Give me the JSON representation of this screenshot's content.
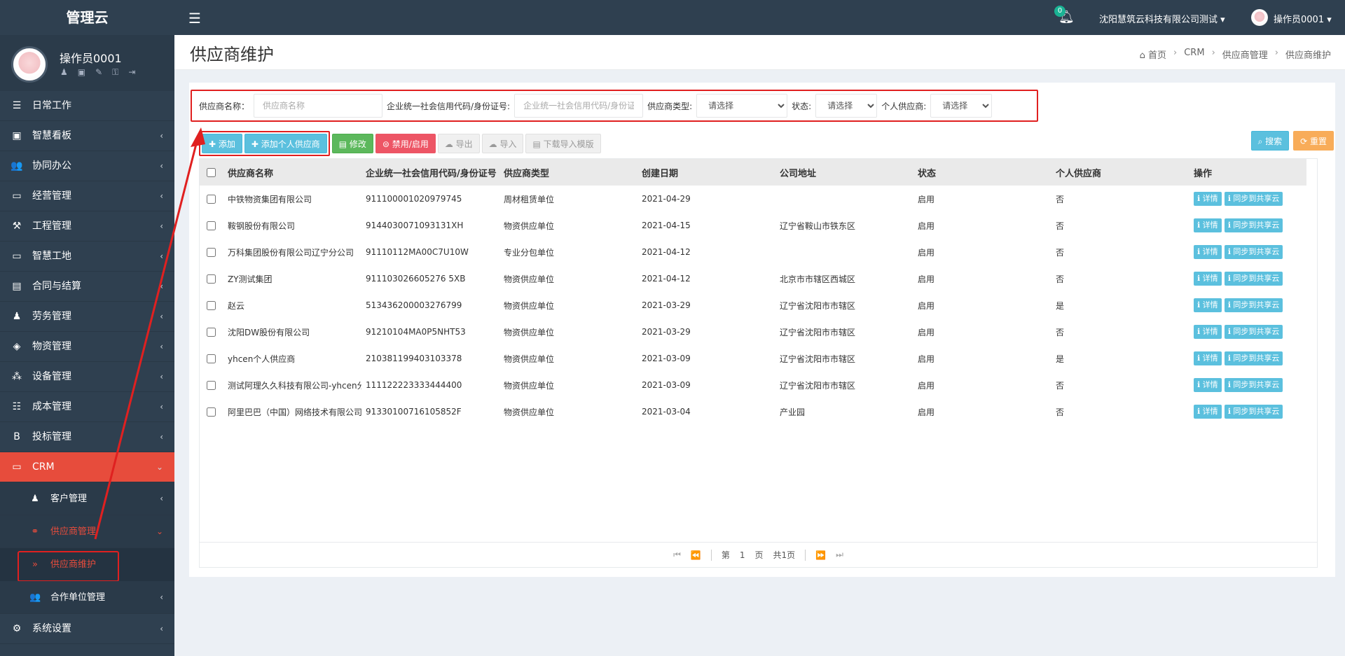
{
  "app": {
    "logo": "管理云"
  },
  "sidebar": {
    "user_name": "操作员0001",
    "menu": [
      {
        "label": "日常工作",
        "icon": "list-icon",
        "glyph": "☰",
        "arrow": ""
      },
      {
        "label": "智慧看板",
        "icon": "dashboard-icon",
        "glyph": "▣",
        "arrow": "‹"
      },
      {
        "label": "协同办公",
        "icon": "users-icon",
        "glyph": "👥",
        "arrow": "‹"
      },
      {
        "label": "经营管理",
        "icon": "monitor-icon",
        "glyph": "▭",
        "arrow": "‹"
      },
      {
        "label": "工程管理",
        "icon": "gavel-icon",
        "glyph": "⚒",
        "arrow": "‹"
      },
      {
        "label": "智慧工地",
        "icon": "monitor-icon",
        "glyph": "▭",
        "arrow": "‹"
      },
      {
        "label": "合同与结算",
        "icon": "file-icon",
        "glyph": "▤",
        "arrow": "‹"
      },
      {
        "label": "劳务管理",
        "icon": "worker-icon",
        "glyph": "♟",
        "arrow": "‹"
      },
      {
        "label": "物资管理",
        "icon": "cube-icon",
        "glyph": "◈",
        "arrow": "‹"
      },
      {
        "label": "设备管理",
        "icon": "cubes-icon",
        "glyph": "⁂",
        "arrow": "‹"
      },
      {
        "label": "成本管理",
        "icon": "list-icon",
        "glyph": "☷",
        "arrow": "‹"
      },
      {
        "label": "投标管理",
        "icon": "bold-icon",
        "glyph": "B",
        "arrow": "‹"
      }
    ],
    "crm": {
      "label": "CRM",
      "glyph": "▭",
      "arrow": "⌄"
    },
    "crm_sub": {
      "customer": {
        "label": "客户管理",
        "glyph": "♟",
        "arrow": "‹"
      },
      "supplier": {
        "label": "供应商管理",
        "glyph": "⚭",
        "arrow": "⌄"
      },
      "supplier_maint": {
        "label": "供应商维护",
        "glyph": "»"
      },
      "partner": {
        "label": "合作单位管理",
        "glyph": "👥",
        "arrow": "‹"
      }
    },
    "settings": {
      "label": "系统设置",
      "glyph": "⚙",
      "arrow": "‹"
    }
  },
  "topbar": {
    "hamburger": "☰",
    "notify_count": "0",
    "company": "沈阳慧筑云科技有限公司测试 ▾",
    "user": "操作员0001 ▾"
  },
  "page": {
    "title": "供应商维护",
    "breadcrumb": [
      "首页",
      "CRM",
      "供应商管理",
      "供应商维护"
    ]
  },
  "search": {
    "name_label": "供应商名称：",
    "name_placeholder": "供应商名称",
    "credit_label": "企业统一社会信用代码/身份证号:",
    "credit_placeholder": "企业统一社会信用代码/身份证号",
    "type_label": "供应商类型:",
    "type_value": "请选择",
    "status_label": "状态:",
    "status_value": "请选择",
    "personal_label": "个人供应商:",
    "personal_value": "请选择"
  },
  "toolbar": {
    "add": "✚ 添加",
    "add_personal": "✚ 添加个人供应商",
    "edit": "▤ 修改",
    "toggle": "⊜ 禁用/启用",
    "export": "☁ 导出",
    "import": "☁ 导入",
    "template": "▤ 下载导入模版",
    "search": "⌕ 搜索",
    "reset": "⟳ 重置"
  },
  "table": {
    "headers": [
      "供应商名称",
      "企业统一社会信用代码/身份证号",
      "供应商类型",
      "创建日期",
      "公司地址",
      "状态",
      "个人供应商",
      "操作"
    ],
    "op_detail": "ℹ 详情",
    "op_sync": "ℹ 同步到共享云",
    "rows": [
      [
        "中铁物资集团有限公司",
        "911100001020979745",
        "周材租赁单位",
        "2021-04-29",
        "",
        "启用",
        "否"
      ],
      [
        "鞍钢股份有限公司",
        "9144030071093131XH",
        "物资供应单位",
        "2021-04-15",
        "辽宁省鞍山市铁东区",
        "启用",
        "否"
      ],
      [
        "万科集团股份有限公司辽宁分公司",
        "91110112MA00C7U10W",
        "专业分包单位",
        "2021-04-12",
        "",
        "启用",
        "否"
      ],
      [
        "ZY测试集团",
        "911103026605276 5XB",
        "物资供应单位",
        "2021-04-12",
        "北京市市辖区西城区",
        "启用",
        "否"
      ],
      [
        "赵云",
        "513436200003276799",
        "物资供应单位",
        "2021-03-29",
        "辽宁省沈阳市市辖区",
        "启用",
        "是"
      ],
      [
        "沈阳DW股份有限公司",
        "91210104MA0P5NHT53",
        "物资供应单位",
        "2021-03-29",
        "辽宁省沈阳市市辖区",
        "启用",
        "否"
      ],
      [
        "yhcen个人供应商",
        "210381199403103378",
        "物资供应单位",
        "2021-03-09",
        "辽宁省沈阳市市辖区",
        "启用",
        "是"
      ],
      [
        "测试阿理久久科技有限公司-yhcen分",
        "111122223333444400",
        "物资供应单位",
        "2021-03-09",
        "辽宁省沈阳市市辖区",
        "启用",
        "否"
      ],
      [
        "阿里巴巴（中国）网络技术有限公司",
        "91330100716105852F",
        "物资供应单位",
        "2021-03-04",
        "产业园",
        "启用",
        "否"
      ]
    ]
  },
  "pager": {
    "page_prefix": "第",
    "page_value": "1",
    "page_suffix": "页",
    "total": "共1页"
  }
}
